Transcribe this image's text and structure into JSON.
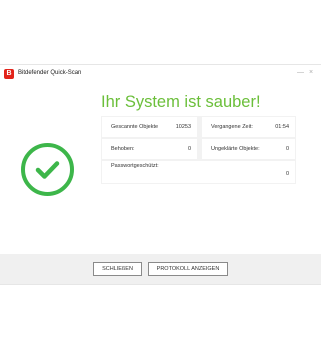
{
  "window": {
    "title": "Bitdefender Quick-Scan",
    "logo_letter": "B",
    "minimize_glyph": "—",
    "close_glyph": "×"
  },
  "result": {
    "headline": "Ihr System ist sauber!",
    "status_icon": "check-circle-icon",
    "accent_color": "#3db64a"
  },
  "stats": {
    "scanned_label": "Gescannte Objekte",
    "scanned_value": "10253",
    "elapsed_label": "Vergangene Zeit:",
    "elapsed_value": "01:54",
    "fixed_label": "Behoben:",
    "fixed_value": "0",
    "unresolved_label": "Ungeklärte Objekte:",
    "unresolved_value": "0",
    "password_label": "Passwortgeschützt:",
    "password_value": "0"
  },
  "footer": {
    "close_label": "SCHLIEßEN",
    "log_label": "PROTOKOLL ANZEIGEN"
  }
}
